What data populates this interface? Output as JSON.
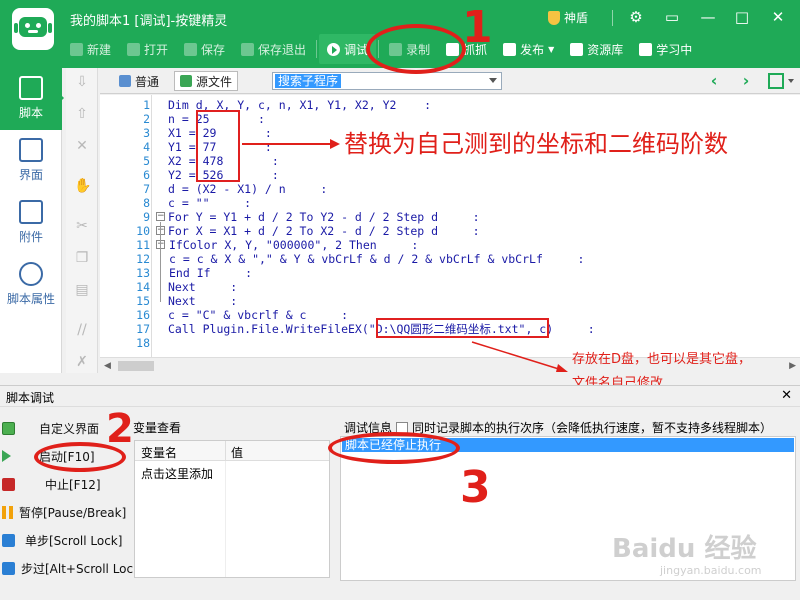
{
  "window": {
    "title": "我的脚本1 [调试]-按键精灵",
    "shendun_label": "神盾",
    "icons": [
      "gear-icon",
      "minimize-icon",
      "maximize-icon",
      "close-icon"
    ]
  },
  "toolbar": {
    "new_label": "新建",
    "open_label": "打开",
    "save_label": "保存",
    "save_exit_label": "保存退出",
    "debug_label": "调试",
    "record_label": "录制",
    "capture_label": "抓抓",
    "publish_label": "发布",
    "resources_label": "资源库",
    "learn_label": "学习中"
  },
  "leftnav": {
    "items": [
      {
        "label": "脚本",
        "icon": "script-icon"
      },
      {
        "label": "界面",
        "icon": "ui-icon"
      },
      {
        "label": "附件",
        "icon": "attachment-icon"
      },
      {
        "label": "脚本属性",
        "icon": "info-icon"
      }
    ]
  },
  "editor": {
    "tab_normal": "普通",
    "tab_source": "源文件",
    "proc_search": "搜索子程序",
    "lines": [
      {
        "n": "1",
        "code": "Dim d, X, Y, c, n, X1, Y1, X2, Y2    :"
      },
      {
        "n": "2",
        "code": "n = 25       :"
      },
      {
        "n": "3",
        "code": "X1 = 29       :"
      },
      {
        "n": "4",
        "code": "Y1 = 77       :"
      },
      {
        "n": "5",
        "code": "X2 = 478       :"
      },
      {
        "n": "6",
        "code": "Y2 = 526       :"
      },
      {
        "n": "7",
        "code": "d = (X2 - X1) / n     :"
      },
      {
        "n": "8",
        "code": "c = \"\"     :"
      },
      {
        "n": "9",
        "code": "For Y = Y1 + d / 2 To Y2 - d / 2 Step d     :"
      },
      {
        "n": "10",
        "code": "For X = X1 + d / 2 To X2 - d / 2 Step d     :"
      },
      {
        "n": "11",
        "code": "IfColor X, Y, \"000000\", 2 Then     :"
      },
      {
        "n": "12",
        "code": "c = c & X & \",\" & Y & vbCrLf & d / 2 & vbCrLf & vbCrLf     :"
      },
      {
        "n": "13",
        "code": "End If     :"
      },
      {
        "n": "14",
        "code": "Next     :"
      },
      {
        "n": "15",
        "code": "Next     :"
      },
      {
        "n": "16",
        "code": "c = \"C\" & vbcrlf & c     :"
      },
      {
        "n": "17",
        "code": "Call Plugin.File.WriteFileEX(\"D:\\QQ圆形二维码坐标.txt\", c)     :"
      },
      {
        "n": "18",
        "code": ""
      }
    ]
  },
  "annotations": {
    "replace_note": "替换为自己测到的坐标和二维码阶数",
    "storage_note": "存放在D盘，也可以是其它盘，文件名自己修改",
    "num1": "1",
    "num2": "2",
    "num3": "3"
  },
  "debug": {
    "panel_title": "脚本调试",
    "close_label": "✕",
    "custom_ui_label": "自定义界面",
    "start_label": "启动[F10]",
    "stop_label": "中止[F12]",
    "pause_label": "暂停[Pause/Break]",
    "step_label": "单步[Scroll Lock]",
    "step_over_label": "步过[Alt+Scroll Lock]",
    "var_view_title": "变量查看",
    "var_col_name": "变量名",
    "var_col_value": "值",
    "var_add_hint": "点击这里添加",
    "info_label": "调试信息",
    "record_order_label": "同时记录脚本的执行次序（会降低执行速度，暂不支持多线程脚本）",
    "log_lines": [
      "脚本已经停止执行"
    ]
  },
  "watermark": {
    "brand": "Baidu 经验",
    "url": "jingyan.baidu.com"
  },
  "colors": {
    "brand_green": "#1faa57",
    "annotation_red": "#e0201a",
    "keyword_blue": "#1a1aa6",
    "selection_blue": "#3399ff"
  }
}
